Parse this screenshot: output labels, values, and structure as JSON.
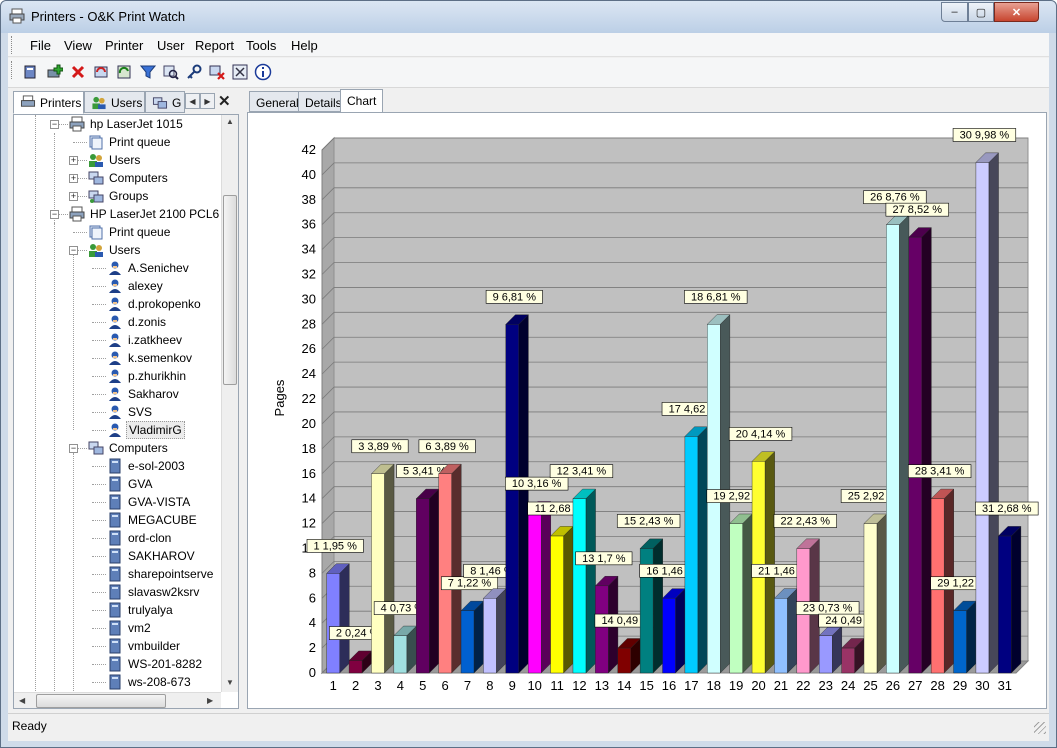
{
  "window": {
    "title": "Printers - O&K Print Watch"
  },
  "titlebar_buttons": {
    "minimize": "–",
    "maximize": "▢",
    "close": "✕"
  },
  "menu": [
    "File",
    "View",
    "Printer",
    "User",
    "Report",
    "Tools",
    "Help"
  ],
  "toolbar_icons": [
    "printer-icon",
    "add-icon",
    "delete-icon",
    "refresh-icon",
    "update-icon",
    "filter-icon",
    "search-icon",
    "key-icon",
    "remove-printer-icon",
    "settings-icon",
    "info-icon"
  ],
  "left_tabs": [
    {
      "label": "Printers",
      "icon": "printer-icon"
    },
    {
      "label": "Users",
      "icon": "users-icon"
    },
    {
      "label": "G",
      "icon": "groups-icon"
    }
  ],
  "left_pane_close": "✕",
  "tree": [
    {
      "label": "hp LaserJet 1015",
      "icon": "printer",
      "level": 0,
      "expander": "−"
    },
    {
      "label": "Print queue",
      "icon": "queue",
      "level": 1,
      "expander": ""
    },
    {
      "label": "Users",
      "icon": "users",
      "level": 1,
      "expander": "+"
    },
    {
      "label": "Computers",
      "icon": "computers",
      "level": 1,
      "expander": "+"
    },
    {
      "label": "Groups",
      "icon": "groups",
      "level": 1,
      "expander": "+"
    },
    {
      "label": "HP LaserJet 2100 PCL6",
      "icon": "printer",
      "level": 0,
      "expander": "−"
    },
    {
      "label": "Print queue",
      "icon": "queue",
      "level": 1,
      "expander": ""
    },
    {
      "label": "Users",
      "icon": "users",
      "level": 1,
      "expander": "−"
    },
    {
      "label": "A.Senichev",
      "icon": "user",
      "level": 2,
      "expander": ""
    },
    {
      "label": "alexey",
      "icon": "user",
      "level": 2,
      "expander": ""
    },
    {
      "label": "d.prokopenko",
      "icon": "user",
      "level": 2,
      "expander": ""
    },
    {
      "label": "d.zonis",
      "icon": "user",
      "level": 2,
      "expander": ""
    },
    {
      "label": "i.zatkheev",
      "icon": "user",
      "level": 2,
      "expander": ""
    },
    {
      "label": "k.semenkov",
      "icon": "user",
      "level": 2,
      "expander": ""
    },
    {
      "label": "p.zhurikhin",
      "icon": "user",
      "level": 2,
      "expander": ""
    },
    {
      "label": "Sakharov",
      "icon": "user",
      "level": 2,
      "expander": ""
    },
    {
      "label": "SVS",
      "icon": "user",
      "level": 2,
      "expander": ""
    },
    {
      "label": "VladimirG",
      "icon": "user",
      "level": 2,
      "expander": "",
      "selected": true
    },
    {
      "label": "Computers",
      "icon": "computers",
      "level": 1,
      "expander": "−"
    },
    {
      "label": "e-sol-2003",
      "icon": "computer",
      "level": 2,
      "expander": ""
    },
    {
      "label": "GVA",
      "icon": "computer",
      "level": 2,
      "expander": ""
    },
    {
      "label": "GVA-VISTA",
      "icon": "computer",
      "level": 2,
      "expander": ""
    },
    {
      "label": "MEGACUBE",
      "icon": "computer",
      "level": 2,
      "expander": ""
    },
    {
      "label": "ord-clon",
      "icon": "computer",
      "level": 2,
      "expander": ""
    },
    {
      "label": "SAKHAROV",
      "icon": "computer",
      "level": 2,
      "expander": ""
    },
    {
      "label": "sharepointserve",
      "icon": "computer",
      "level": 2,
      "expander": ""
    },
    {
      "label": "slavasw2ksrv",
      "icon": "computer",
      "level": 2,
      "expander": ""
    },
    {
      "label": "trulyalya",
      "icon": "computer",
      "level": 2,
      "expander": ""
    },
    {
      "label": "vm2",
      "icon": "computer",
      "level": 2,
      "expander": ""
    },
    {
      "label": "vmbuilder",
      "icon": "computer",
      "level": 2,
      "expander": ""
    },
    {
      "label": "WS-201-8282",
      "icon": "computer",
      "level": 2,
      "expander": ""
    },
    {
      "label": "ws-208-673",
      "icon": "computer",
      "level": 2,
      "expander": ""
    }
  ],
  "right_tabs": [
    {
      "label": "General",
      "active": false
    },
    {
      "label": "Details",
      "active": false
    },
    {
      "label": "Chart",
      "active": true
    }
  ],
  "status": {
    "text": "Ready"
  },
  "chart_data": {
    "type": "bar",
    "ylabel": "Pages",
    "xlabel": "",
    "ylim": [
      0,
      42
    ],
    "yticks": [
      0,
      2,
      4,
      6,
      8,
      10,
      12,
      14,
      16,
      18,
      20,
      22,
      24,
      26,
      28,
      30,
      32,
      34,
      36,
      38,
      40,
      42
    ],
    "categories": [
      "1",
      "2",
      "3",
      "4",
      "5",
      "6",
      "7",
      "8",
      "9",
      "10",
      "11",
      "12",
      "13",
      "14",
      "15",
      "16",
      "17",
      "18",
      "19",
      "20",
      "21",
      "22",
      "23",
      "24",
      "25",
      "26",
      "27",
      "28",
      "29",
      "30",
      "31"
    ],
    "values": [
      8,
      1,
      16,
      3,
      14,
      16,
      5,
      6,
      28,
      13,
      11,
      14,
      7,
      2,
      10,
      6,
      19,
      28,
      12,
      17,
      6,
      10,
      3,
      2,
      12,
      36,
      35,
      14,
      5,
      41,
      11
    ],
    "labels": [
      "1 1,95 %",
      "2 0,24 %",
      "3 3,89 %",
      "4 0,73 %",
      "5 3,41 %",
      "6 3,89 %",
      "7 1,22 %",
      "8 1,46 %",
      "9 6,81 %",
      "10 3,16 %",
      "11 2,68 %",
      "12 3,41 %",
      "13 1,7 %",
      "14 0,49 %",
      "15 2,43 %",
      "16 1,46 %",
      "17 4,62 %",
      "18 6,81 %",
      "19 2,92 %",
      "20 4,14 %",
      "21 1,46 %",
      "22 2,43 %",
      "23 0,73 %",
      "24 0,49 %",
      "25 2,92 %",
      "26 8,76 %",
      "27 8,52 %",
      "28 3,41 %",
      "29 1,22 %",
      "30 9,98 %",
      "31 2,68 %"
    ],
    "colors": [
      "#8080ff",
      "#800040",
      "#ffffc0",
      "#a0e0e0",
      "#600060",
      "#ff8080",
      "#0060d0",
      "#c0c0ff",
      "#000080",
      "#ff00ff",
      "#ffff00",
      "#00ffff",
      "#800080",
      "#800000",
      "#008080",
      "#0000ff",
      "#00ccff",
      "#d0ffff",
      "#c0ffc0",
      "#ffff30",
      "#90c0ff",
      "#ff99cc",
      "#9999ff",
      "#993366",
      "#ffffcc",
      "#ccffff",
      "#660066",
      "#ff7070",
      "#0066cc",
      "#ccccff",
      "#000080"
    ],
    "grid": true,
    "legend": "none"
  }
}
